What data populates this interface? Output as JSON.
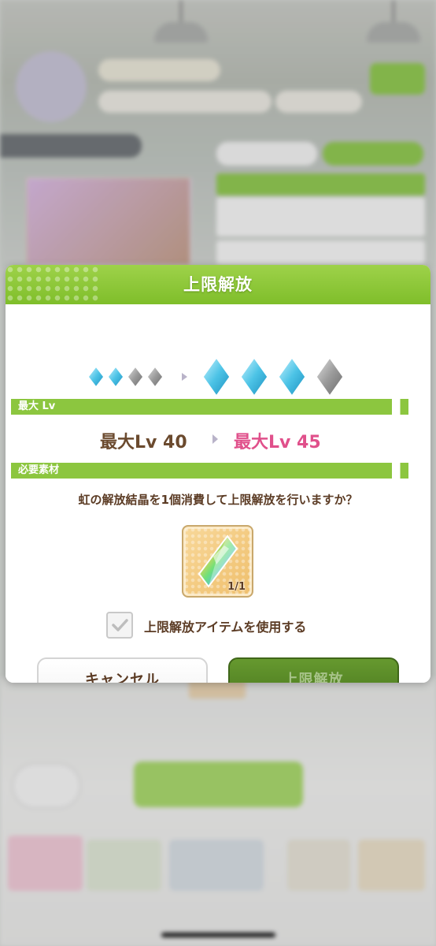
{
  "dialog": {
    "title": "上限解放",
    "current_stars": 2,
    "next_stars": 3,
    "max_stars": 4,
    "section_level_label": "最大 Lv",
    "current_max_level": "最大Lv 40",
    "next_max_level": "最大Lv 45",
    "section_material_label": "必要素材",
    "confirm_message": "虹の解放結晶を1個消費して上限解放を行いますか？",
    "item": {
      "name_icon": "rainbow-crystal-icon",
      "count": "1/1"
    },
    "use_item_checkbox": {
      "label": "上限解放アイテムを使用する",
      "checked": true
    },
    "cancel_label": "キャンセル",
    "confirm_label": "上限解放"
  },
  "colors": {
    "header_green": "#8cc63f",
    "level_current": "#6b4a2e",
    "level_next": "#e0508b",
    "confirm_button": "#4c7a1f"
  }
}
